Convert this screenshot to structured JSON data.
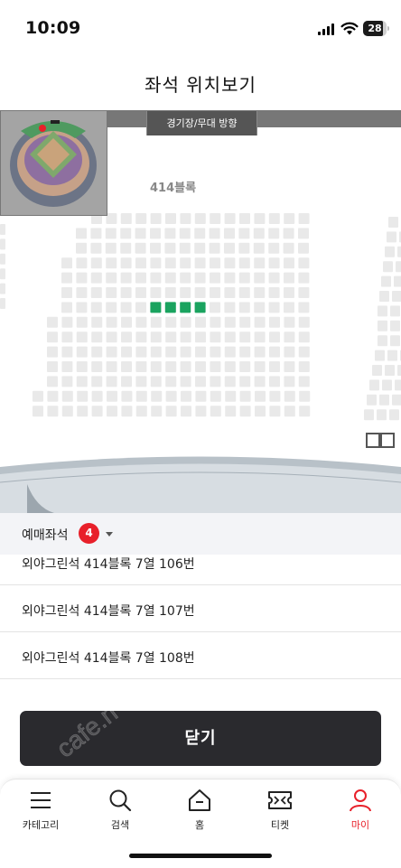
{
  "status_bar": {
    "time": "10:09",
    "battery": "28"
  },
  "header": {
    "title": "좌석 위치보기"
  },
  "seat_map": {
    "direction_label": "경기장/무대 방향",
    "block_label": "414블록",
    "selected_seat_color": "#1aa35f",
    "seat_color": "#e9e9e9",
    "stand_color": "#b7c0c7"
  },
  "summary": {
    "label": "예매좌석",
    "count": "4"
  },
  "seats": [
    {
      "label": "외야그린석 414블록 7열 106번"
    },
    {
      "label": "외야그린석 414블록 7열 107번"
    },
    {
      "label": "외야그린석 414블록 7열 108번"
    }
  ],
  "close_label": "닫기",
  "watermark_text": "cafe.n",
  "nav": [
    {
      "label": "카테고리",
      "icon": "menu-icon"
    },
    {
      "label": "검색",
      "icon": "search-icon"
    },
    {
      "label": "홈",
      "icon": "home-icon"
    },
    {
      "label": "티켓",
      "icon": "ticket-icon"
    },
    {
      "label": "마이",
      "icon": "person-icon"
    }
  ],
  "colors": {
    "accent": "#e8202a",
    "button_dark": "#2a2a2e"
  }
}
